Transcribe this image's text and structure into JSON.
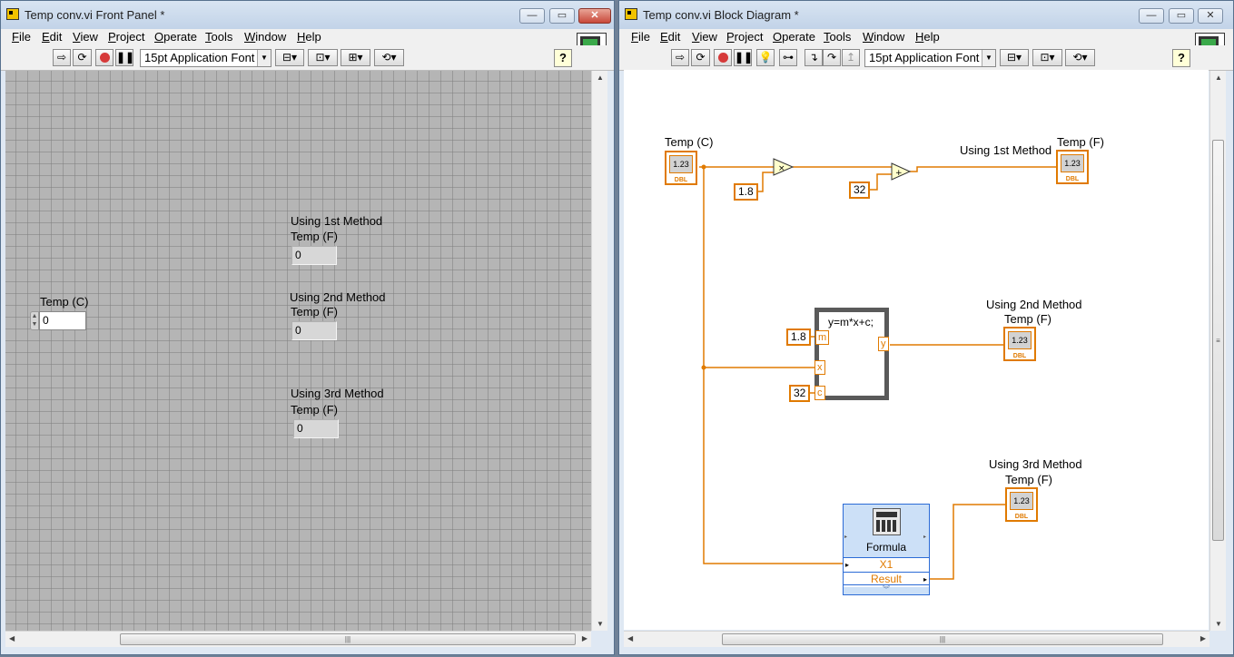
{
  "front_panel": {
    "title": "Temp conv.vi Front Panel *",
    "menu": [
      "File",
      "Edit",
      "View",
      "Project",
      "Operate",
      "Tools",
      "Window",
      "Help"
    ],
    "font_selector": "15pt Application Font",
    "connector_num": "1",
    "control": {
      "label": "Temp (C)",
      "value": "0"
    },
    "indicators": [
      {
        "caption": "Using 1st Method",
        "label": "Temp (F)",
        "value": "0"
      },
      {
        "caption": "Using 2nd Method",
        "label": "Temp (F)",
        "value": "0"
      },
      {
        "caption": "Using 3rd Method",
        "label": "Temp (F)",
        "value": "0"
      }
    ]
  },
  "block_diagram": {
    "title": "Temp conv.vi Block Diagram *",
    "menu": [
      "File",
      "Edit",
      "View",
      "Project",
      "Operate",
      "Tools",
      "Window",
      "Help"
    ],
    "font_selector": "15pt Application Font",
    "connector_num": "1",
    "input_terminal": {
      "label": "Temp (C)",
      "display": "1.23",
      "type": "DBL"
    },
    "const_multiply": "1.8",
    "const_add": "32",
    "output_1": {
      "caption": "Using 1st Method",
      "label": "Temp (F)",
      "display": "1.23",
      "type": "DBL"
    },
    "formula_node": {
      "code": "y=m*x+c;",
      "m": "m",
      "x": "x",
      "c": "c",
      "y": "y",
      "const_m": "1.8",
      "const_c": "32"
    },
    "output_2": {
      "caption": "Using 2nd Method",
      "label": "Temp (F)",
      "display": "1.23",
      "type": "DBL"
    },
    "express_formula": {
      "name": "Formula",
      "input": "X1",
      "output": "Result"
    },
    "output_3": {
      "caption": "Using 3rd Method",
      "label": "Temp (F)",
      "display": "1.23",
      "type": "DBL"
    }
  },
  "colors": {
    "wire_dbl": "#e07a00",
    "panel_grid": "#b5b5b5",
    "express_vi": "#cce0f7"
  },
  "icons": [
    "labview-vi-icon",
    "run-arrow-icon",
    "run-continuously-icon",
    "abort-icon",
    "pause-icon",
    "highlight-execution-icon",
    "retain-wire-values-icon",
    "step-into-icon",
    "step-over-icon",
    "step-out-icon",
    "align-icon",
    "distribute-icon",
    "resize-icon",
    "reorder-icon",
    "cleanup-icon",
    "context-help-icon",
    "multiply-icon",
    "add-icon"
  ]
}
